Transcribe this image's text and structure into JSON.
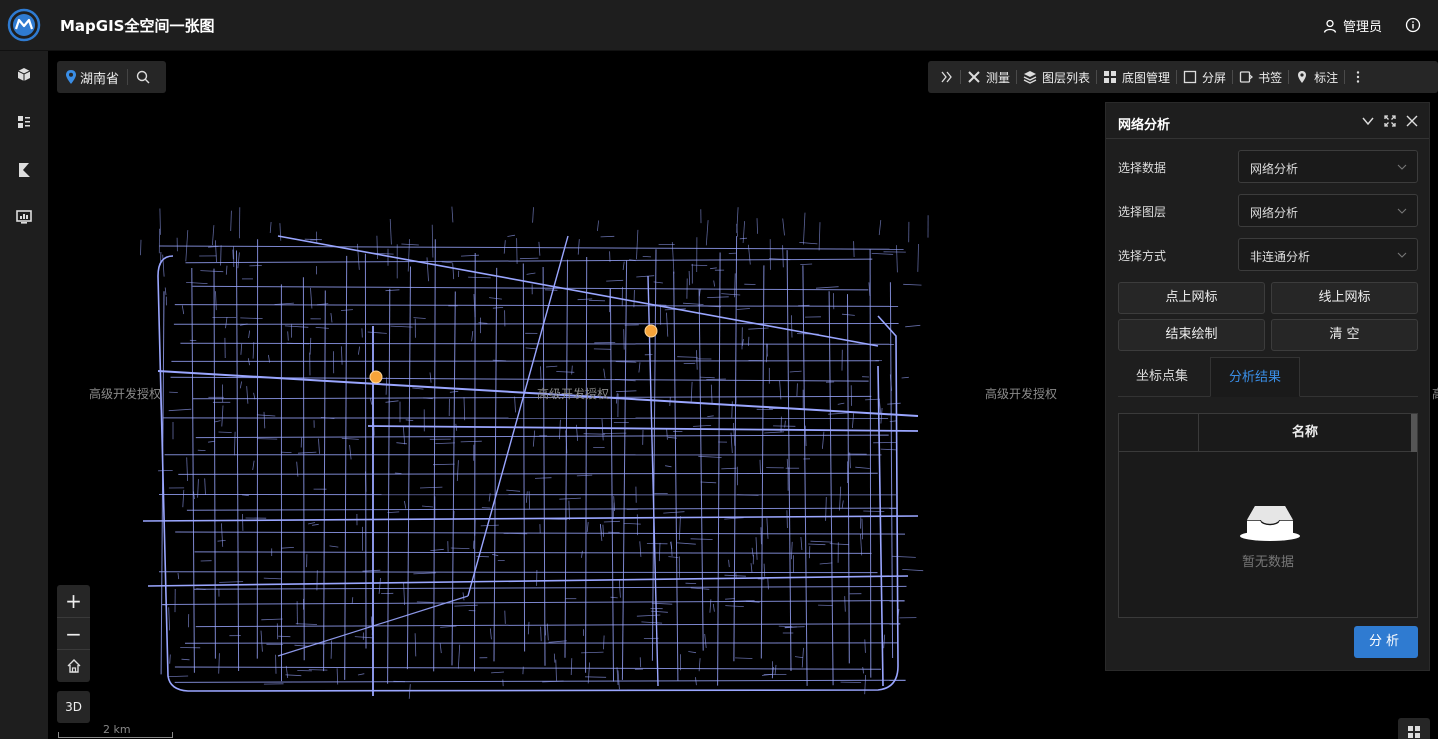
{
  "header": {
    "app_title": "MapGIS全空间一张图",
    "user_name": "管理员"
  },
  "map": {
    "location": "湖南省",
    "watermarks": [
      "高级开发授权",
      "高级开发授权",
      "高级开发授权",
      "高"
    ],
    "scale_label": "2 km",
    "zoom_in": "+",
    "zoom_out": "−",
    "btn_3d": "3D",
    "road_color": "#9aa6ff",
    "marker_color": "#f7a43a"
  },
  "toolbar": {
    "items": [
      {
        "label": "测量",
        "icon": "ruler-icon"
      },
      {
        "label": "图层列表",
        "icon": "layers-icon"
      },
      {
        "label": "底图管理",
        "icon": "grid-icon"
      },
      {
        "label": "分屏",
        "icon": "split-icon"
      },
      {
        "label": "书签",
        "icon": "bookmark-icon"
      },
      {
        "label": "标注",
        "icon": "pin-icon"
      }
    ]
  },
  "panel": {
    "title": "网络分析",
    "rows": [
      {
        "label": "选择数据",
        "value": "网络分析"
      },
      {
        "label": "选择图层",
        "value": "网络分析"
      },
      {
        "label": "选择方式",
        "value": "非连通分析"
      }
    ],
    "buttons": [
      "点上网标",
      "线上网标",
      "结束绘制",
      "清 空"
    ],
    "tabs": [
      "坐标点集",
      "分析结果"
    ],
    "active_tab": "分析结果",
    "table_header": "名称",
    "empty_text": "暂无数据",
    "analyze_label": "分析",
    "accent_color": "#2f7bd1"
  }
}
